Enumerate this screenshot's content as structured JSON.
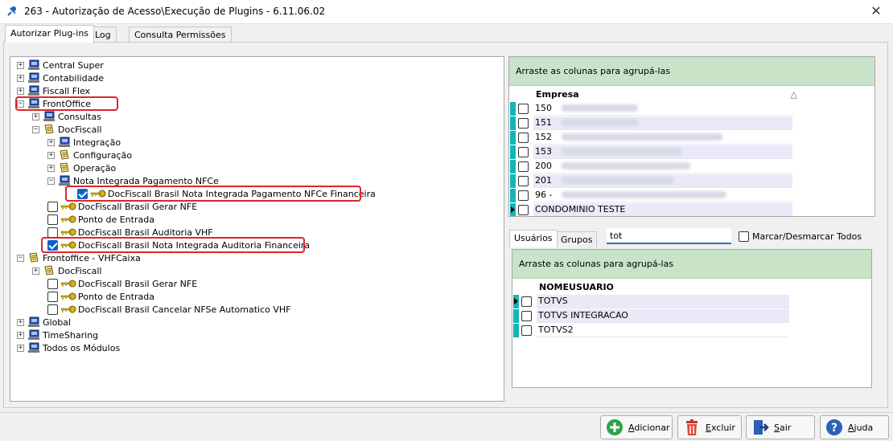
{
  "window": {
    "title": "263 - Autorização de Acesso\\Execução de Plugins - 6.11.06.02"
  },
  "tabs": [
    {
      "label": "Autorizar Plug-ins"
    },
    {
      "label": "Log"
    },
    {
      "label": "Consulta Permissões"
    }
  ],
  "tree": [
    {
      "label": "Central Super"
    },
    {
      "label": "Contabilidade"
    },
    {
      "label": "Fiscall Flex"
    },
    {
      "label": "FrontOffice"
    },
    {
      "label": "Consultas"
    },
    {
      "label": "DocFiscall"
    },
    {
      "label": "Integração"
    },
    {
      "label": "Configuração"
    },
    {
      "label": "Operação"
    },
    {
      "label": "Nota Integrada Pagamento NFCe"
    },
    {
      "label": "DocFiscall Brasil Nota Integrada Pagamento NFCe Financeira"
    },
    {
      "label": "DocFiscall Brasil Gerar NFE"
    },
    {
      "label": "Ponto de Entrada"
    },
    {
      "label": "DocFiscall Brasil Auditoria VHF"
    },
    {
      "label": "DocFiscall Brasil Nota Integrada Auditoria Financeira"
    },
    {
      "label": "Frontoffice - VHFCaixa"
    },
    {
      "label": "DocFiscall"
    },
    {
      "label": "DocFiscall Brasil Gerar NFE"
    },
    {
      "label": "Ponto de Entrada"
    },
    {
      "label": "DocFiscall Brasil Cancelar NFSe Automatico VHF"
    },
    {
      "label": "Global"
    },
    {
      "label": "TimeSharing"
    },
    {
      "label": "Todos os Módulos"
    }
  ],
  "empresa_grid": {
    "group_hint": "Arraste as colunas para agrupá-las",
    "column": "Empresa",
    "sort_glyph": "△",
    "rows": [
      {
        "code": "150"
      },
      {
        "code": "151"
      },
      {
        "code": "152"
      },
      {
        "code": "153"
      },
      {
        "code": "200"
      },
      {
        "code": "201"
      },
      {
        "code": "96 -"
      },
      {
        "code": "CONDOMINIO TESTE"
      }
    ]
  },
  "user_tabs": [
    {
      "label": "Usuários"
    },
    {
      "label": "Grupos"
    }
  ],
  "search": {
    "value": "tot"
  },
  "mark_all": {
    "label": "Marcar/Desmarcar Todos"
  },
  "user_grid": {
    "group_hint": "Arraste as colunas para agrupá-las",
    "column": "NOMEUSUARIO",
    "rows": [
      {
        "name": "TOTVS"
      },
      {
        "name": "TOTVS INTEGRACAO"
      },
      {
        "name": "TOTVS2"
      }
    ]
  },
  "buttons": {
    "add": {
      "first": "A",
      "rest": "dicionar"
    },
    "delete": {
      "first": "E",
      "rest": "xcluir"
    },
    "exit": {
      "first": "S",
      "rest": "air"
    },
    "help": {
      "first": "A",
      "rest": "juda"
    }
  },
  "colors": {
    "group_band": "#c9e3c9",
    "indicator": "#13b6b6",
    "highlight": "#e0242b",
    "check": "#0a64c8"
  }
}
